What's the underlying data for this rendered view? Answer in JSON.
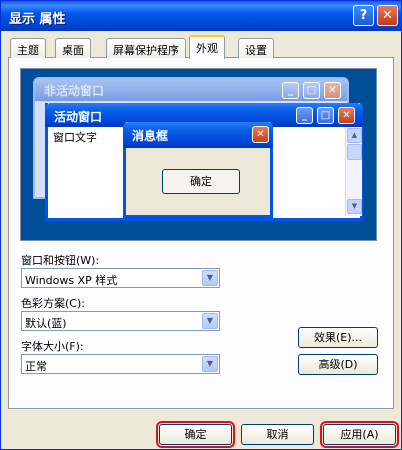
{
  "window": {
    "title": "显示 属性",
    "help_label": "?",
    "close_label": "✕"
  },
  "tabs": [
    {
      "label": "主题"
    },
    {
      "label": "桌面"
    },
    {
      "label": "屏幕保护程序"
    },
    {
      "label": "外观",
      "active": true
    },
    {
      "label": "设置"
    }
  ],
  "preview": {
    "inactive_title": "非活动窗口",
    "active_title": "活动窗口",
    "window_text": "窗口文字",
    "messagebox_title": "消息框",
    "messagebox_ok": "确定",
    "min_glyph": "_",
    "max_glyph": "□",
    "close_glyph": "✕"
  },
  "form": {
    "windows_buttons_label": "窗口和按钮(W):",
    "windows_buttons_value": "Windows XP 样式",
    "color_scheme_label": "色彩方案(C):",
    "color_scheme_value": "默认(蓝)",
    "font_size_label": "字体大小(F):",
    "font_size_value": "正常",
    "effects_button": "效果(E)...",
    "advanced_button": "高级(D)"
  },
  "buttons": {
    "ok": "确定",
    "cancel": "取消",
    "apply": "应用(A)"
  },
  "icons": [
    "help-icon",
    "close-icon",
    "minimize-icon",
    "maximize-icon",
    "dropdown-arrow-icon",
    "scroll-up-icon",
    "scroll-down-icon"
  ],
  "colors": {
    "titlebar": "#0055e5",
    "dialog_bg": "#ece9d8",
    "preview_bg": "#004e98",
    "highlight_outline": "#e0101a"
  }
}
